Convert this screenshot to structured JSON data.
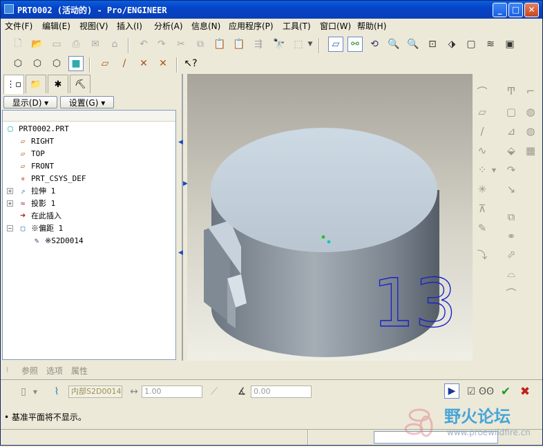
{
  "window": {
    "title": "PRT0002 (活动的) - Pro/ENGINEER",
    "controls": {
      "minimize": "_",
      "maximize": "□",
      "close": "✕"
    }
  },
  "menu": [
    "文件(F)",
    "编辑(E)",
    "视图(V)",
    "插入(I)",
    "分析(A)",
    "信息(N)",
    "应用程序(P)",
    "工具(T)",
    "窗口(W)",
    "帮助(H)"
  ],
  "panel": {
    "display_button": "显示(D) ▾",
    "settings_button": "设置(G) ▾"
  },
  "tree": [
    {
      "label": "PRT0002.PRT",
      "icon": "part-icon"
    },
    {
      "label": "RIGHT",
      "icon": "datum-plane-icon"
    },
    {
      "label": "TOP",
      "icon": "datum-plane-icon"
    },
    {
      "label": "FRONT",
      "icon": "datum-plane-icon"
    },
    {
      "label": "PRT_CSYS_DEF",
      "icon": "csys-icon"
    },
    {
      "label": "拉伸 1",
      "icon": "extrude-icon",
      "expandable": true
    },
    {
      "label": "投影 1",
      "icon": "projection-icon",
      "expandable": true
    },
    {
      "label": "在此插入",
      "icon": "insert-here-icon"
    },
    {
      "label": "※偏距 1",
      "icon": "offset-icon",
      "expandable": true,
      "expanded": true
    },
    {
      "label": "※S2D0014",
      "icon": "sketch-icon"
    }
  ],
  "model_text": "13",
  "dashboard": {
    "tabs": [
      "参照",
      "选项",
      "属性"
    ],
    "sketch_field": "内部S2D0014",
    "distance_value": "1.00",
    "angle_value": "0.00"
  },
  "status": {
    "message": "• 基准平面将不显示。"
  },
  "watermark": {
    "text": "野火论坛",
    "url": "www.proewildfire.cn"
  },
  "colors": {
    "titlebar": "#0a50d8",
    "viewport_top": "#a7a49c",
    "model_top": "#c6d2dc",
    "model_side": "#7c8894",
    "sketch_text": "#1a22c8"
  }
}
